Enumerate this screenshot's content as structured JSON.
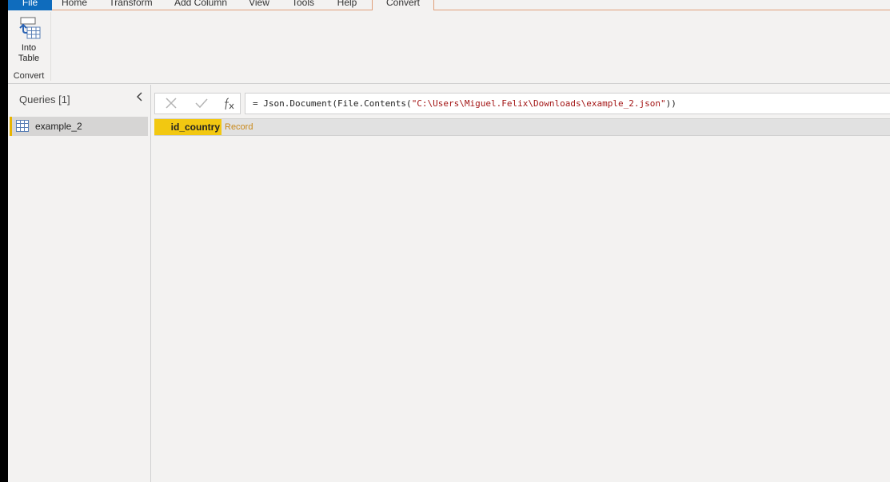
{
  "tabs": [
    "File",
    "Home",
    "Transform",
    "Add Column",
    "View",
    "Tools",
    "Help",
    "Convert"
  ],
  "ribbon": {
    "into_table_line1": "Into",
    "into_table_line2": "Table",
    "group_label": "Convert"
  },
  "queries": {
    "title": "Queries [1]",
    "items": [
      {
        "name": "example_2"
      }
    ]
  },
  "formula": {
    "prefix": "= Json.Document(File.Contents(",
    "path": "\"C:\\Users\\Miguel.Felix\\Downloads\\example_2.json\"",
    "suffix": "))"
  },
  "record": {
    "field": "id_country",
    "value": "Record"
  },
  "colors": {
    "file_tab": "#0f6cbd",
    "accent_yellow": "#f2c811",
    "record_link": "#c9891a",
    "string_literal": "#a31515"
  },
  "icons": {
    "into_table": "into-table-icon",
    "collapse": "chevron-left-icon",
    "table": "table-icon",
    "cancel": "close-icon",
    "commit": "check-icon",
    "fx": "fx-icon"
  }
}
